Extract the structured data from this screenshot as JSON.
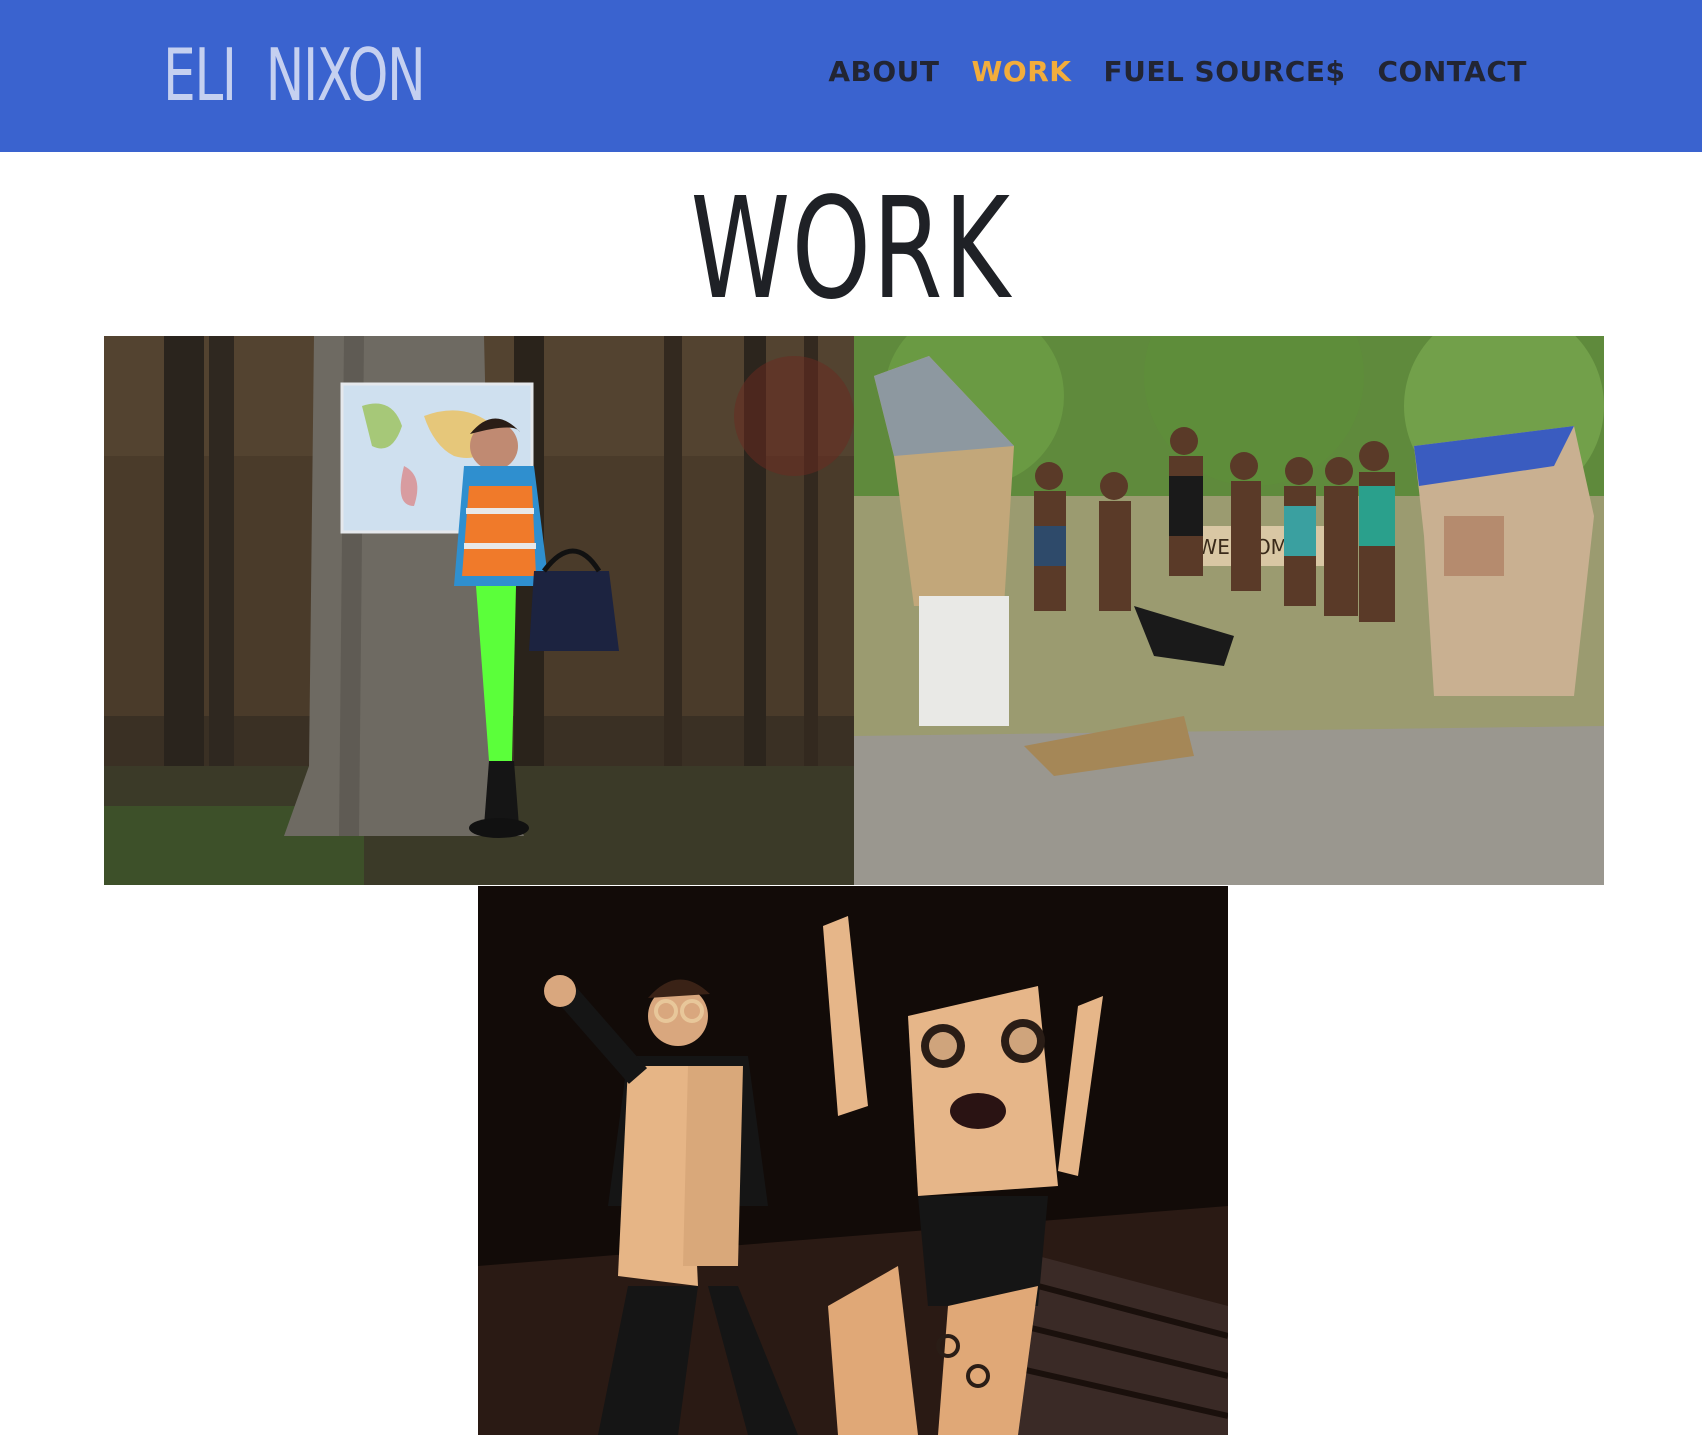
{
  "site": {
    "logo": "ELI  NIXON"
  },
  "nav": {
    "items": [
      {
        "label": "ABOUT",
        "active": false
      },
      {
        "label": "WORK",
        "active": true
      },
      {
        "label": "FUEL SOURCE$",
        "active": false
      },
      {
        "label": "CONTACT",
        "active": false
      }
    ]
  },
  "page": {
    "title": "WORK"
  },
  "colors": {
    "header_bg": "#3a63cf",
    "logo": "#c5d0f0",
    "nav_text": "#222533",
    "nav_active": "#f2ad3c",
    "title": "#1f2126"
  },
  "gallery": {
    "photos": [
      {
        "subject": "performer in blue jacket, orange safety vest and green leggings beside tree with world map in forest"
      },
      {
        "subject": "group of young people posing with cardboard houses and a WELCOME sign in a park"
      },
      {
        "subject": "stage performers in cardboard costumes, one as a monster with goggles"
      }
    ]
  }
}
